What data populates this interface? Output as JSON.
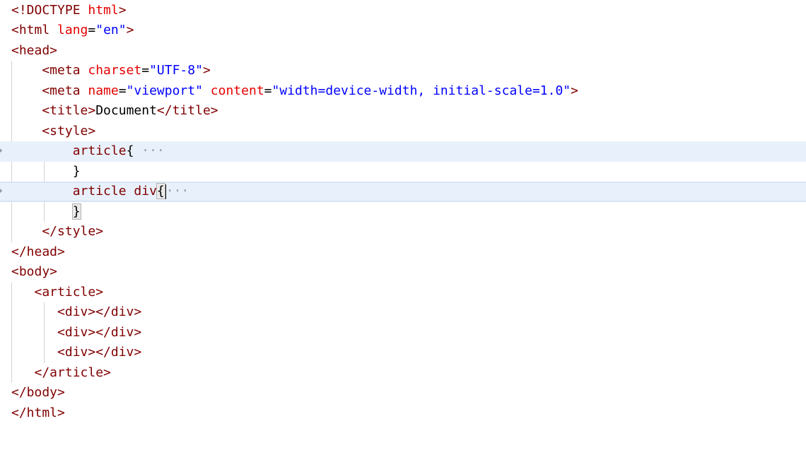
{
  "editor": {
    "lines": [
      [
        {
          "t": "<!DOCTYPE ",
          "c": "tag"
        },
        {
          "t": "html",
          "c": "attr"
        },
        {
          "t": ">",
          "c": "tag"
        }
      ],
      [
        {
          "t": "<html ",
          "c": "tag"
        },
        {
          "t": "lang",
          "c": "attr"
        },
        {
          "t": "=",
          "c": "text"
        },
        {
          "t": "\"en\"",
          "c": "str"
        },
        {
          "t": ">",
          "c": "tag"
        }
      ],
      [
        {
          "t": "<head>",
          "c": "tag"
        }
      ],
      [
        {
          "t": "    <meta ",
          "c": "tag"
        },
        {
          "t": "charset",
          "c": "attr"
        },
        {
          "t": "=",
          "c": "text"
        },
        {
          "t": "\"UTF-8\"",
          "c": "str"
        },
        {
          "t": ">",
          "c": "tag"
        }
      ],
      [
        {
          "t": "    <meta ",
          "c": "tag"
        },
        {
          "t": "name",
          "c": "attr"
        },
        {
          "t": "=",
          "c": "text"
        },
        {
          "t": "\"viewport\"",
          "c": "str"
        },
        {
          "t": " ",
          "c": "text"
        },
        {
          "t": "content",
          "c": "attr"
        },
        {
          "t": "=",
          "c": "text"
        },
        {
          "t": "\"width=device-width, initial-scale=1.0\"",
          "c": "str"
        },
        {
          "t": ">",
          "c": "tag"
        }
      ],
      [
        {
          "t": "    <title>",
          "c": "tag"
        },
        {
          "t": "Document",
          "c": "text"
        },
        {
          "t": "</title>",
          "c": "tag"
        }
      ],
      [
        {
          "t": "    <style>",
          "c": "tag"
        }
      ],
      [
        {
          "t": "        article",
          "c": "sel"
        },
        {
          "t": "{",
          "c": "text"
        },
        {
          "t": " ···",
          "c": "fold"
        }
      ],
      [
        {
          "t": "        }",
          "c": "text"
        }
      ],
      [
        {
          "t": "        article div",
          "c": "sel"
        },
        {
          "t": "{",
          "c": "text",
          "cursor": true
        },
        {
          "t": "···",
          "c": "fold"
        }
      ],
      [
        {
          "t": "        ",
          "c": "text"
        },
        {
          "t": "}",
          "c": "text",
          "match": true
        }
      ],
      [
        {
          "t": "    </style>",
          "c": "tag"
        }
      ],
      [
        {
          "t": "</head>",
          "c": "tag"
        }
      ],
      [
        {
          "t": "<body>",
          "c": "tag"
        }
      ],
      [
        {
          "t": "   <article>",
          "c": "tag"
        }
      ],
      [
        {
          "t": "      <div></div>",
          "c": "tag"
        }
      ],
      [
        {
          "t": "      <div></div>",
          "c": "tag"
        }
      ],
      [
        {
          "t": "      <div></div>",
          "c": "tag"
        }
      ],
      [
        {
          "t": "   </article>",
          "c": "tag"
        }
      ],
      [
        {
          "t": "</body>",
          "c": "tag"
        }
      ],
      [
        {
          "t": "</html>",
          "c": "tag"
        }
      ]
    ],
    "highlighted_lines": [
      7,
      9
    ],
    "folded_lines": [
      7,
      9
    ]
  }
}
